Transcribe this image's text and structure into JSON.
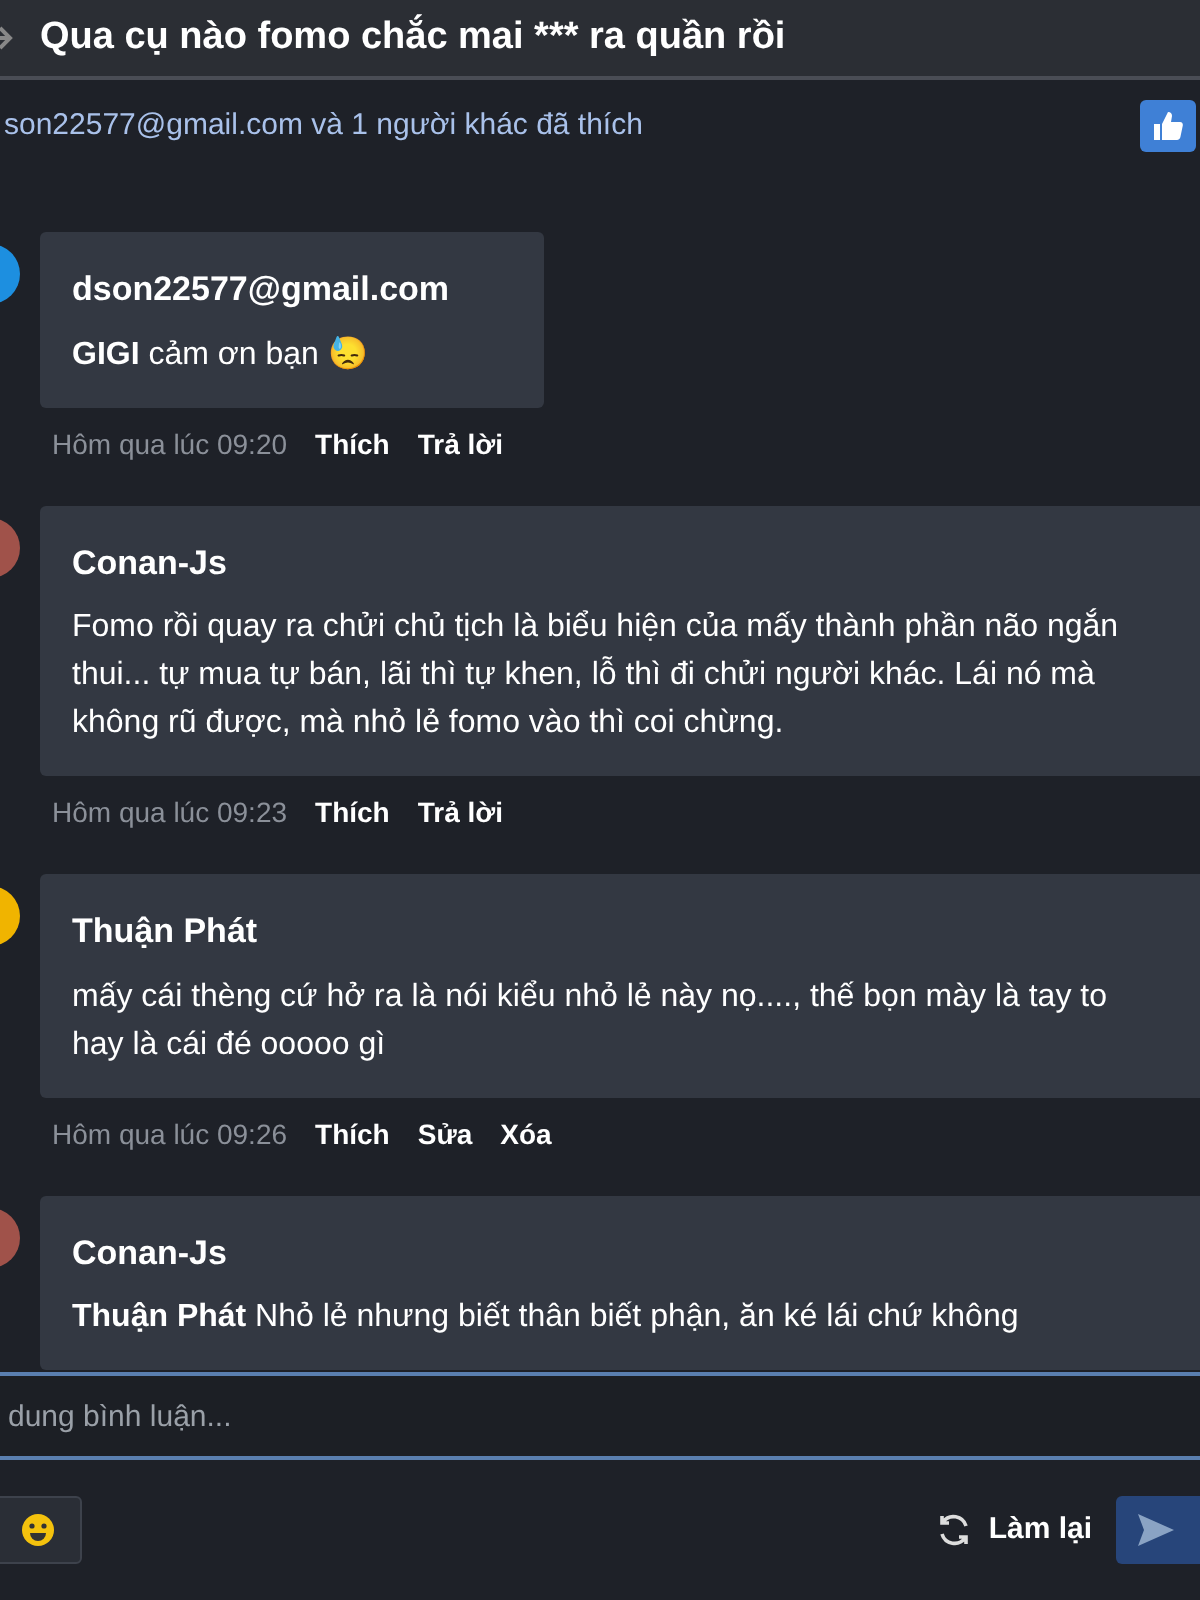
{
  "header": {
    "title": "Qua cụ nào fomo chắc mai *** ra quần rồi"
  },
  "likes": {
    "text": "son22577@gmail.com và 1 người khác đã thích"
  },
  "comments": [
    {
      "author": "dson22577@gmail.com",
      "text": "**GIGI** cảm ơn bạn 😓",
      "time": "Hôm qua lúc 09:20",
      "color": "#1d8fe0",
      "actions": [
        "Thích",
        "Trả lời"
      ]
    },
    {
      "author": "Conan-Js",
      "text": "Fomo rồi quay ra chửi chủ tịch là biểu hiện của mấy thành phần não ngắn thui... tự mua tự bán, lãi thì tự khen, lỗ thì đi chửi người khác. Lái nó mà không rũ được, mà nhỏ lẻ fomo vào thì coi chừng.",
      "time": "Hôm qua lúc 09:23",
      "color": "#a0524a",
      "actions": [
        "Thích",
        "Trả lời"
      ]
    },
    {
      "author": "Thuận Phát",
      "text": "mấy cái thèng cứ hở ra là nói kiểu nhỏ lẻ này nọ...., thế bọn mày là tay to hay là cái đé ooooo gì",
      "time": "Hôm qua lúc 09:26",
      "color": "#f0b400",
      "actions": [
        "Thích",
        "Sửa",
        "Xóa"
      ]
    },
    {
      "author": "Conan-Js",
      "text": "**Thuận Phát** Nhỏ lẻ nhưng biết thân biết phận, ăn ké lái chứ không",
      "color": "#a0524a"
    }
  ],
  "composer": {
    "placeholder": "dung bình luận...",
    "reset": "Làm lại"
  }
}
